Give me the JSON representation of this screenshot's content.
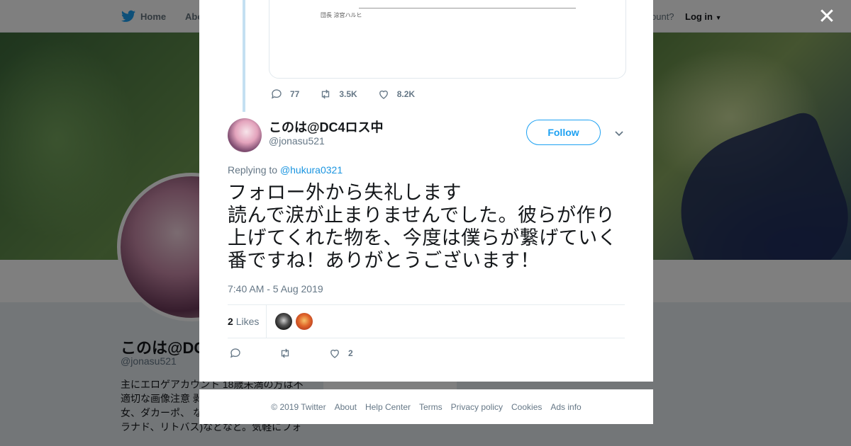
{
  "nav": {
    "home": "Home",
    "about": "Abo",
    "account_prompt": "ccount?",
    "login": "Log in"
  },
  "background_profile": {
    "name": "このは@DC",
    "handle": "@jonasu521",
    "bio": "主にエロゲアカウント 18歳未満の方は不適切な画像注意 剥 ニメ→リバーズエ 女、ダカーポ、 なのは、key(kanon、ク ラナド、リトバス)などなど。気軽にフォ",
    "card_text": "Ads info"
  },
  "close": "✕",
  "quoted": {
    "media_caption": "団長 涼宮ハルヒ",
    "replies": "77",
    "retweets": "3.5K",
    "likes": "8.2K"
  },
  "tweet": {
    "display_name": "このは@DC4ロス中",
    "handle": "@jonasu521",
    "follow_label": "Follow",
    "replying_prefix": "Replying to",
    "replying_to": "@hukura0321",
    "text": "フォロー外から失礼します\n読んで涙が止まりませんでした。彼らが作り上げてくれた物を、今度は僕らが繋げていく番ですね！ありがとうございます！",
    "timestamp": "7:40 AM - 5 Aug 2019",
    "like_count": "2",
    "likes_label": "Likes",
    "action_like_count": "2"
  },
  "footer": {
    "copyright": "© 2019 Twitter",
    "links": [
      "About",
      "Help Center",
      "Terms",
      "Privacy policy",
      "Cookies",
      "Ads info"
    ]
  },
  "colors": {
    "accent": "#1da1f2",
    "link": "#1b95e0",
    "muted": "#657786",
    "thread_line": "#c4e0f2"
  }
}
